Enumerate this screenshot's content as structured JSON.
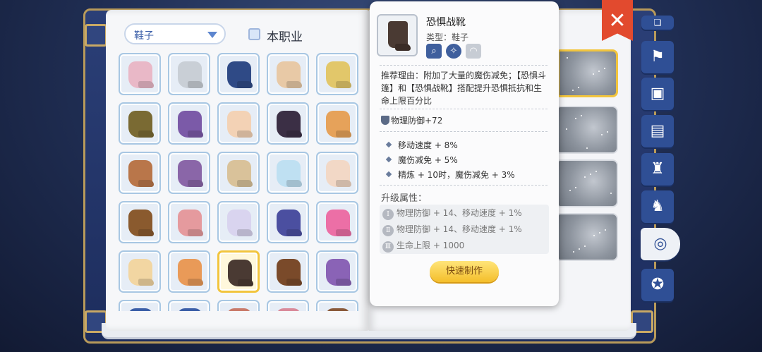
{
  "filter": {
    "label": "鞋子"
  },
  "class_filter": {
    "label": "本职业",
    "checked": false
  },
  "grid_items": [
    {
      "color": "#e9b8c7"
    },
    {
      "color": "#c9cfd6"
    },
    {
      "color": "#2f4a86"
    },
    {
      "color": "#e8c9a6"
    },
    {
      "color": "#e2c76a"
    },
    {
      "color": "#7a6a33"
    },
    {
      "color": "#7b5aa8"
    },
    {
      "color": "#f3d2b5"
    },
    {
      "color": "#3b2f45"
    },
    {
      "color": "#e6a25a"
    },
    {
      "color": "#b9764a"
    },
    {
      "color": "#8a66a8"
    },
    {
      "color": "#d9c29a"
    },
    {
      "color": "#bfe0f2"
    },
    {
      "color": "#f2d8c6"
    },
    {
      "color": "#8a5a2e"
    },
    {
      "color": "#e59a9e"
    },
    {
      "color": "#d9d4ef"
    },
    {
      "color": "#4b4fa0"
    },
    {
      "color": "#ec6fa6"
    },
    {
      "color": "#f2d6a2"
    },
    {
      "color": "#e99a58"
    },
    {
      "color": "#4a3a33",
      "selected": true
    },
    {
      "color": "#7a4a2a"
    },
    {
      "color": "#8a63b6"
    },
    {
      "color": "#3b5fa8"
    },
    {
      "color": "#3b5fa8"
    },
    {
      "color": "#c97a6a"
    },
    {
      "color": "#d98a9a"
    },
    {
      "color": "#8a5a3a"
    }
  ],
  "tooltip": {
    "name": "恐惧战靴",
    "type": "类型：鞋子",
    "reason": "推荐理由：附加了大量的魔伤减免；【恐惧斗篷】和【恐惧战靴】搭配提升恐惧抵抗和生命上限百分比",
    "base_stat": "物理防御+72",
    "stats": [
      "移动速度 + 8%",
      "魔伤减免 + 5%",
      "精炼 + 10时，魔伤减免 + 3%"
    ],
    "upgrade_title": "升级属性：",
    "upgrades": [
      {
        "tier": "Ⅰ",
        "text": "物理防御 + 14、移动速度 + 1%"
      },
      {
        "tier": "Ⅱ",
        "text": "物理防御 + 14、移动速度 + 1%"
      },
      {
        "tier": "Ⅲ",
        "text": "生命上限 + 1000"
      }
    ],
    "craft_button": "快速制作"
  },
  "side_tabs": [
    {
      "icon": "book-icon",
      "glyph": "❏"
    },
    {
      "icon": "map-icon",
      "glyph": "⚑"
    },
    {
      "icon": "card-icon",
      "glyph": "▣"
    },
    {
      "icon": "toolbox-icon",
      "glyph": "▤"
    },
    {
      "icon": "chair-icon",
      "glyph": "♜"
    },
    {
      "icon": "rocking-horse-icon",
      "glyph": "♞"
    },
    {
      "icon": "headwear-icon",
      "glyph": "◎",
      "active": true
    },
    {
      "icon": "medal-icon",
      "glyph": "✪"
    }
  ],
  "close_glyph": "✕"
}
